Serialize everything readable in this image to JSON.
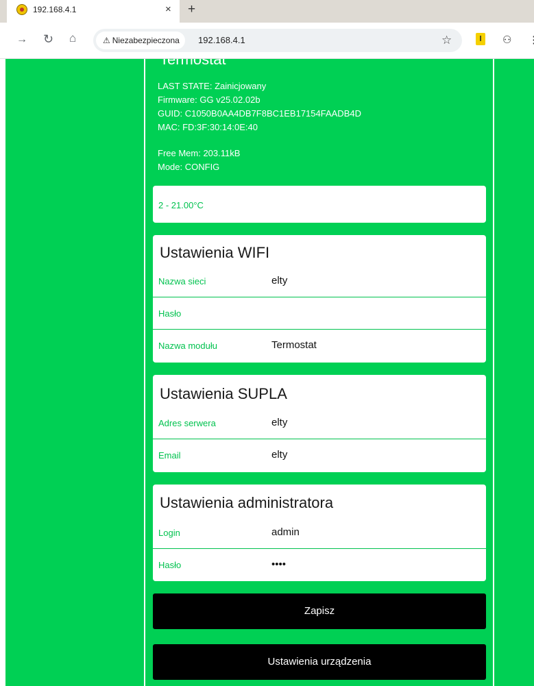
{
  "browser": {
    "tab_title": "192.168.4.1",
    "tab_close": "×",
    "new_tab": "+",
    "security_label": "Niezabezpieczona",
    "url": "192.168.4.1"
  },
  "header": {
    "title": "Termostat",
    "last_state": "LAST STATE: Zainicjowany",
    "firmware": "Firmware: GG v25.02.02b",
    "guid": "GUID: C1050B0AA4DB7F8BC1EB17154FAADB4D",
    "mac": "MAC: FD:3F:30:14:0E:40",
    "free_mem": "Free Mem: 203.11kB",
    "mode": "Mode: CONFIG"
  },
  "sensor": {
    "text": "2 - 21.00°C"
  },
  "wifi": {
    "title": "Ustawienia WIFI",
    "rows": [
      {
        "label": "Nazwa sieci",
        "value": "elty"
      },
      {
        "label": "Hasło",
        "value": ""
      },
      {
        "label": "Nazwa modułu",
        "value": "Termostat"
      }
    ]
  },
  "supla": {
    "title": "Ustawienia SUPLA",
    "rows": [
      {
        "label": "Adres serwera",
        "value": "elty"
      },
      {
        "label": "Email",
        "value": "elty"
      }
    ]
  },
  "admin": {
    "title": "Ustawienia administratora",
    "rows": [
      {
        "label": "Login",
        "value": "admin"
      },
      {
        "label": "Hasło",
        "value": "••••"
      }
    ]
  },
  "buttons": {
    "save": "Zapisz",
    "device_settings": "Ustawienia urządzenia"
  },
  "colors": {
    "background": "#00d054",
    "accent_text": "#00c24e",
    "button": "#000000"
  }
}
